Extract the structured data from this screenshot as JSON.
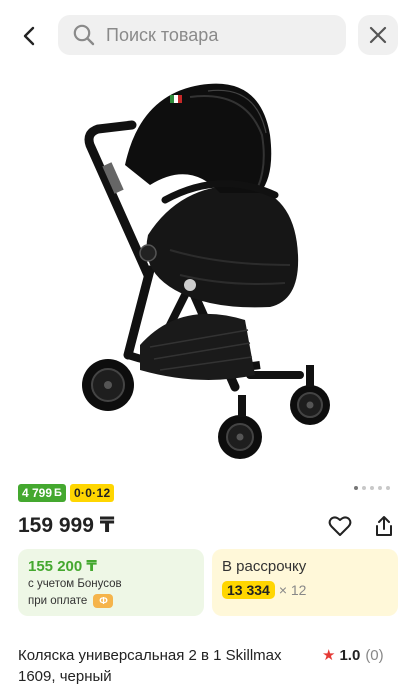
{
  "search": {
    "placeholder": "Поиск товара"
  },
  "product": {
    "badges": {
      "bonus_amount": "4 799",
      "bonus_currency": "Б",
      "installment_plan": "0·0·12"
    },
    "price": "159 999 ₸",
    "bonus_card": {
      "price": "155 200 ₸",
      "line1": "с учетом Бонусов",
      "line2": "при оплате",
      "coin_label": "Ф"
    },
    "installment_card": {
      "title": "В рассрочку",
      "amount": "13 334",
      "multiplier": "× 12"
    },
    "title": "Коляска универсальная 2 в 1 Skillmax 1609, черный",
    "rating": {
      "value": "1.0",
      "count": "(0)"
    },
    "image_count": 5,
    "active_image_index": 0
  },
  "colors": {
    "bonus_green": "#44a82f",
    "installment_yellow": "#ffd600",
    "rating_star": "#e53935"
  }
}
